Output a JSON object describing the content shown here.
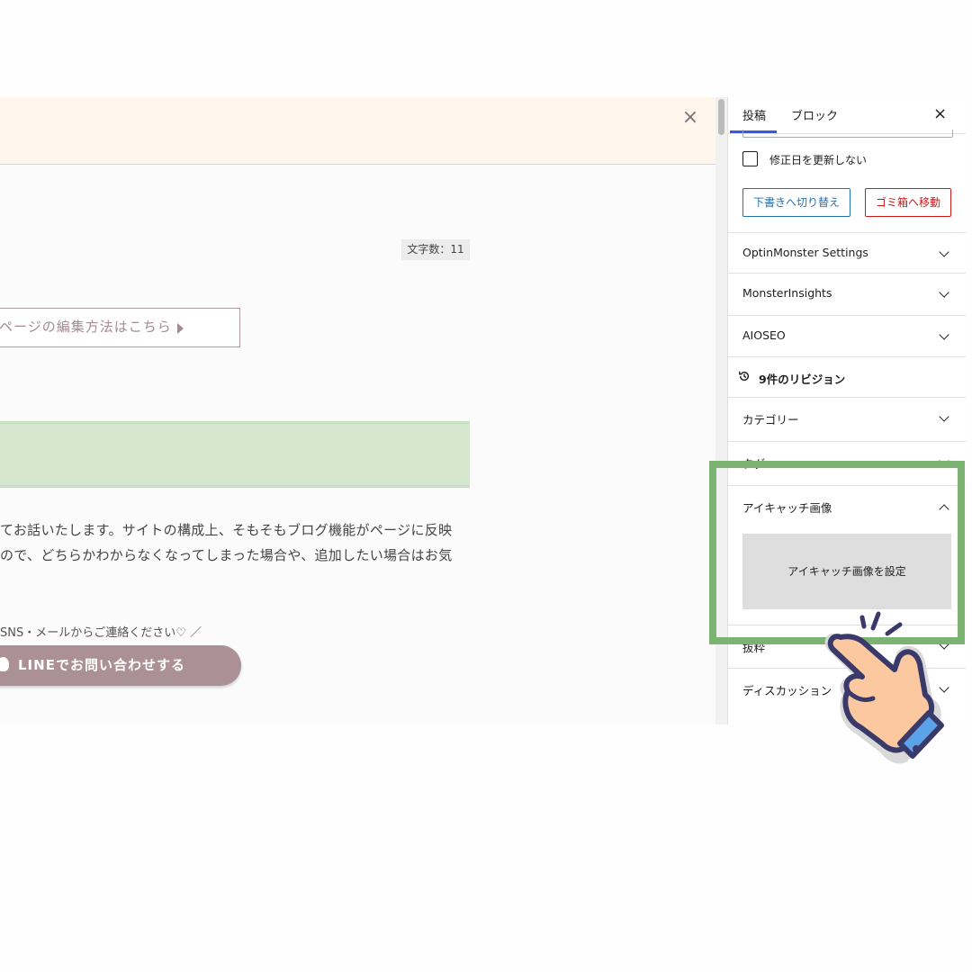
{
  "editor": {
    "notice_close": "×",
    "word_count": "文字数：11",
    "edit_guide_label": "ページの編集方法はこちら",
    "paragraph_line1": "てお話いたします。サイトの構成上、そもそもブログ機能がページに反映",
    "paragraph_line2": "ので、どちらかわからなくなってしまった場合や、追加したい場合はお気",
    "contact_text": "SNS・メールからご連絡ください♡ ／",
    "line_button_label": "LINEでお問い合わせする"
  },
  "sidebar": {
    "tabs": [
      {
        "label": "投稿",
        "active": true
      },
      {
        "label": "ブロック",
        "active": false
      }
    ],
    "close": "×",
    "checkbox_label": "修正日を更新しない",
    "checkbox_checked": false,
    "draft_button": "下書きへ切り替え",
    "trash_button": "ゴミ箱へ移動",
    "panels": [
      {
        "title": "OptinMonster Settings",
        "expanded": false
      },
      {
        "title": "MonsterInsights",
        "expanded": false
      },
      {
        "title": "AIOSEO",
        "expanded": false
      },
      {
        "title": "9件のリビジョン",
        "icon": "history-icon"
      },
      {
        "title": "カテゴリー",
        "expanded": false
      },
      {
        "title": "タグ",
        "expanded": false
      },
      {
        "title": "アイキャッチ画像",
        "expanded": true
      },
      {
        "title": "抜粋",
        "expanded": false
      },
      {
        "title": "ディスカッション",
        "expanded": false
      }
    ],
    "featured_image_button": "アイキャッチ画像を設定"
  },
  "colors": {
    "highlight": "#7cb373",
    "accent_blue": "#2271b1",
    "danger_red": "#cc1818",
    "line_button": "#ab9196"
  },
  "overlay": {
    "pointer_icon": "tapping-hand-icon"
  }
}
